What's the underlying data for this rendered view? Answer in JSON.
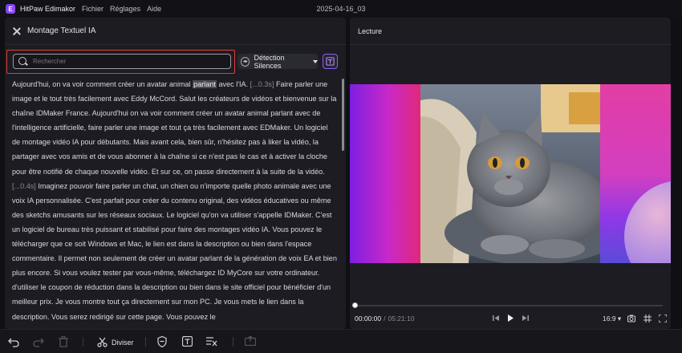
{
  "app": {
    "name": "HitPaw Edimakor",
    "logo_letter": "E",
    "menu": [
      "Fichier",
      "Réglages",
      "Aide"
    ],
    "project_title": "2025-04-16_03"
  },
  "left_panel": {
    "title": "Montage Textuel IA",
    "search": {
      "placeholder": "Rechercher",
      "value": ""
    },
    "silence_button": "Détection Silences",
    "transcript": {
      "p1": "Aujourd'hui, on va voir comment créer un avatar animal ",
      "p1_highlight": "parlant",
      "p2": " avec l'IA. ",
      "ts1": "[...0.3s]",
      "p3": "  Faire parler une image et le tout très facilement avec Eddy McCord. Salut les créateurs de vidéos et bienvenue sur la chaîne IDMaker France. Aujourd'hui on va voir comment créer un avatar animal parlant avec de l'intelligence artificielle, faire parler une image et tout ça très facilement avec EDMaker. Un logiciel de montage vidéo IA pour débutants. Mais avant cela, bien sûr, n'hésitez pas à liker la vidéo, la partager avec vos amis et de vous abonner à la chaîne si ce n'est pas le cas et à activer la cloche pour être notifié de chaque nouvelle vidéo. Et sur ce, on passe directement à la suite de la vidéo. ",
      "ts2": "[...0.4s]",
      "p4": "  Imaginez pouvoir faire parler un chat, un chien ou n'importe quelle photo animale avec une voix IA personnalisée. C'est parfait pour créer du contenu original, des vidéos éducatives ou même des sketchs amusants sur les réseaux sociaux. Le logiciel qu'on va utiliser s'appelle IDMaker. C'est un logiciel de bureau très puissant et stabilisé pour faire des montages vidéo IA. Vous pouvez le télécharger que ce soit Windows et Mac, le lien est dans la description ou bien dans l'espace commentaire. Il permet non seulement de créer un avatar parlant de la génération de voix EA et bien plus encore. Si vous voulez tester par vous-même, téléchargez ID MyCore sur votre ordinateur. d'utiliser le coupon de réduction dans la description ou bien dans le site officiel pour bénéficier d'un meilleur prix. Je vous montre tout ça directement sur mon PC. Je vous mets le lien dans la description. Vous serez redirigé sur cette page. Vous pouvez le"
    }
  },
  "right_panel": {
    "title": "Lecture",
    "time_current": "00:00:00",
    "time_separator": "/",
    "time_total": "05:21:10",
    "playback_progress": 0,
    "aspect_ratio": "16:9"
  },
  "toolbar": {
    "split_label": "Diviser",
    "icons": [
      "undo-icon",
      "redo-icon",
      "trash-icon",
      "scissors-icon",
      "shield-icon",
      "text-icon",
      "remove-silence-icon",
      "export-icon"
    ]
  },
  "colors": {
    "accent": "#8c5cf0",
    "highlight_border": "#e0412f",
    "panel_bg": "#1c1c22",
    "app_bg": "#101014"
  }
}
